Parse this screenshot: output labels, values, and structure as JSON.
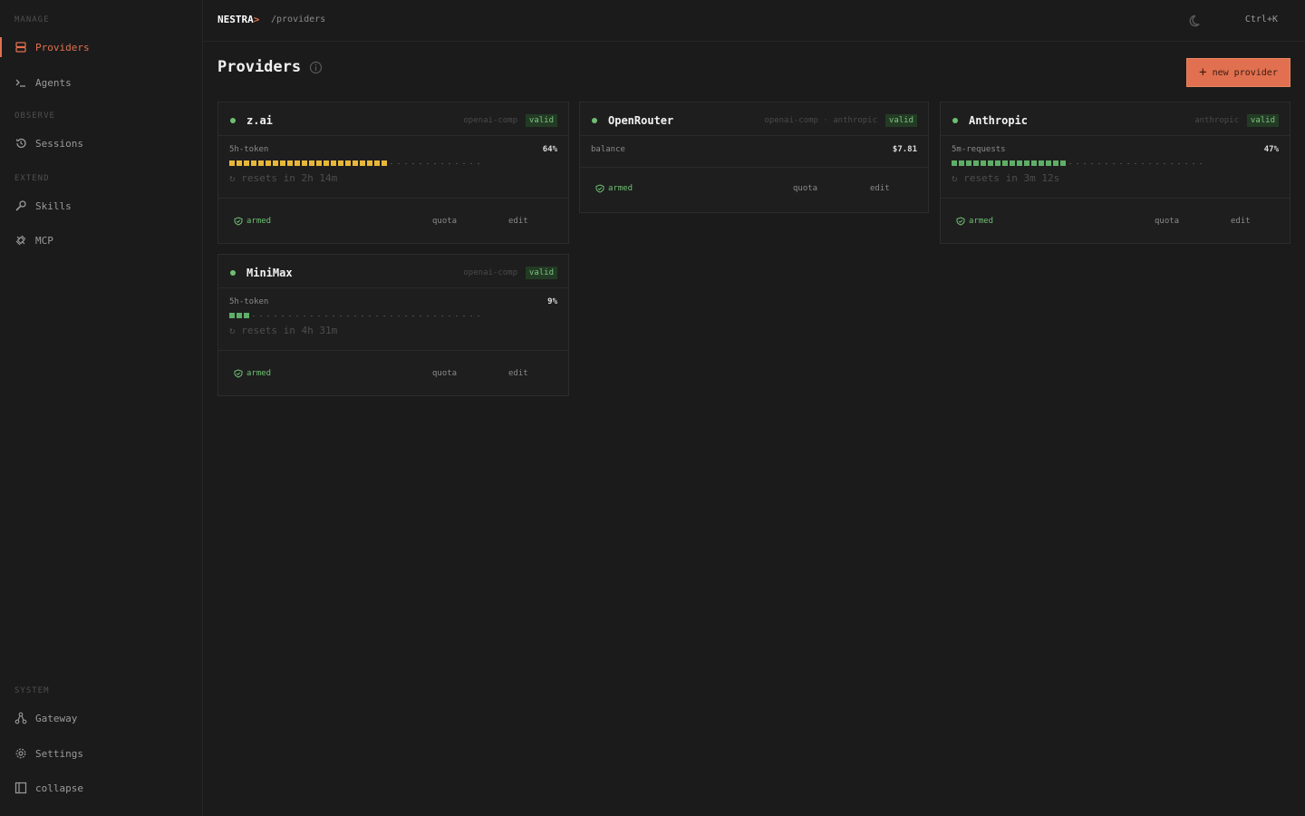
{
  "sidebar": {
    "sections": {
      "manage": "MANAGE",
      "observe": "OBSERVE",
      "extend": "EXTEND",
      "system": "SYSTEM"
    },
    "items": {
      "providers": "Providers",
      "agents": "Agents",
      "sessions": "Sessions",
      "skills": "Skills",
      "mcp": "MCP",
      "gateway": "Gateway",
      "settings": "Settings",
      "collapse": "collapse"
    },
    "active": "providers",
    "accent": "#e0704f"
  },
  "topbar": {
    "brand": "NESTRA",
    "brand_caret": ">",
    "path": "/providers",
    "shortcut": "Ctrl+K",
    "theme_icon": "moon-icon"
  },
  "page": {
    "title": "Providers",
    "new_button": "new provider",
    "new_button_icon": "plus-icon"
  },
  "cards": {
    "zai": {
      "name": "z.ai",
      "tags": "openai-comp",
      "badge": "valid",
      "metric_label": "5h-token",
      "metric_value": "64%",
      "usage_fraction": 0.64,
      "bar_color": "#e8b73a",
      "resets": "↻ resets in 2h 14m",
      "armed": "armed",
      "quota": "quota",
      "edit": "edit"
    },
    "openrouter": {
      "name": "OpenRouter",
      "tags": "openai-comp · anthropic",
      "badge": "valid",
      "metric_label": "balance",
      "metric_value": "$7.81",
      "armed": "armed",
      "quota": "quota",
      "edit": "edit"
    },
    "anthropic": {
      "name": "Anthropic",
      "tags": "anthropic",
      "badge": "valid",
      "metric_label": "5m-requests",
      "metric_value": "47%",
      "usage_fraction": 0.47,
      "bar_color": "#5fae68",
      "resets": "↻ resets in 3m 12s",
      "armed": "armed",
      "quota": "quota",
      "edit": "edit"
    },
    "minimax": {
      "name": "MiniMax",
      "tags": "openai-comp",
      "badge": "valid",
      "metric_label": "5h-token",
      "metric_value": "9%",
      "usage_fraction": 0.09,
      "bar_color": "#5fae68",
      "resets": "↻ resets in 4h 31m",
      "armed": "armed",
      "quota": "quota",
      "edit": "edit"
    }
  },
  "colors": {
    "ok": "#6fbf73",
    "warn": "#e8b73a"
  }
}
